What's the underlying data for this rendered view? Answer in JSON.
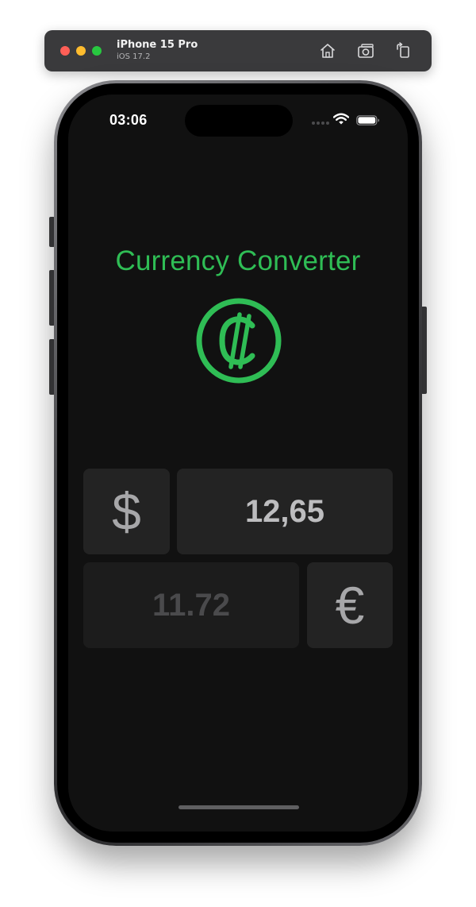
{
  "simulator": {
    "device_name": "iPhone 15 Pro",
    "os_version": "iOS 17.2",
    "buttons": {
      "home_icon": "home-icon",
      "screenshot_icon": "camera-icon",
      "rotate_icon": "rotate-icon"
    }
  },
  "status_bar": {
    "time": "03:06",
    "wifi_icon": "wifi-icon",
    "battery_icon": "battery-icon"
  },
  "app": {
    "title": "Currency Converter",
    "logo_icon": "colon-currency-icon",
    "from": {
      "symbol": "$",
      "amount": "12,65"
    },
    "to": {
      "amount": "11.72",
      "symbol": "€"
    }
  },
  "colors": {
    "accent": "#2fbd55",
    "background": "#111111",
    "tile": "#232323",
    "tile_muted": "#1c1c1c",
    "symbol": "#a7a7a9"
  }
}
